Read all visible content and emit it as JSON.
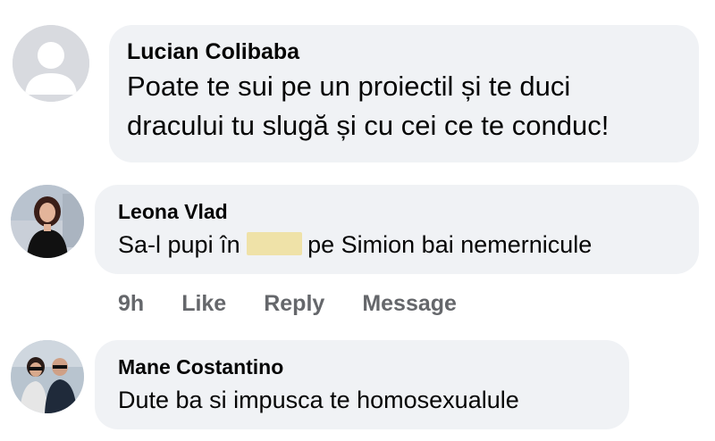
{
  "comments": [
    {
      "author": "Lucian Colibaba",
      "text": "Poate te sui pe un proiectil și te duci dracului  tu slugă și cu cei ce te conduc!",
      "avatar_icon": "default-profile-icon"
    },
    {
      "author": "Leona Vlad",
      "text_before": "Sa-l pupi în",
      "text_after": "pe Simion  bai nemernicule",
      "avatar_icon": "woman-profile-photo",
      "actions": {
        "time": "9h",
        "like": "Like",
        "reply": "Reply",
        "message": "Message"
      }
    },
    {
      "author": "Mane Costantino",
      "text": "Dute ba si impusca te homosexualule",
      "avatar_icon": "couple-profile-photo"
    }
  ],
  "colors": {
    "bubble": "#f0f2f5",
    "text": "#050505",
    "secondary": "#65676b",
    "censor_highlight": "#efe2a8"
  }
}
